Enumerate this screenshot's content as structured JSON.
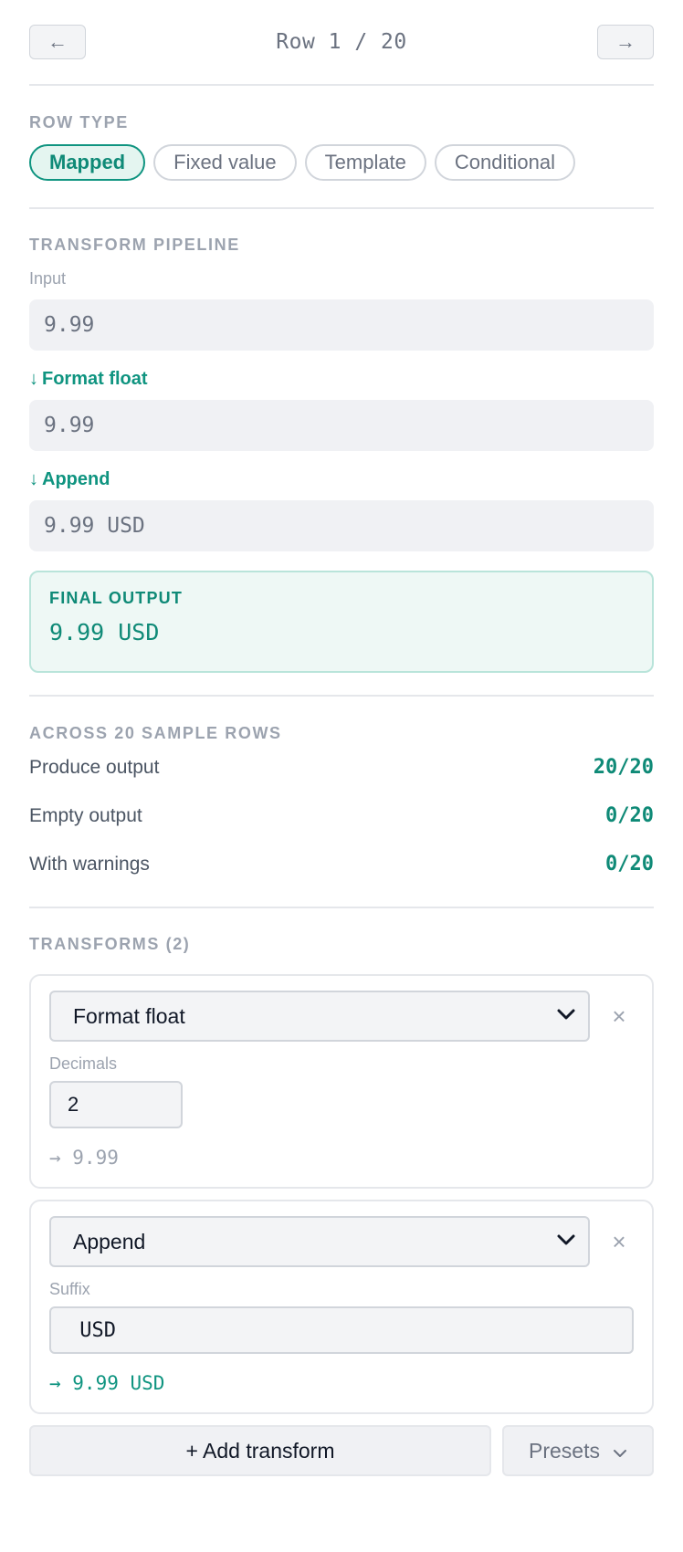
{
  "nav": {
    "prev_icon": "←",
    "next_icon": "→",
    "row_label": "Row 1 / 20"
  },
  "row_type": {
    "title": "ROW TYPE",
    "options": [
      "Mapped",
      "Fixed value",
      "Template",
      "Conditional"
    ],
    "selected": "Mapped"
  },
  "pipeline": {
    "title": "TRANSFORM PIPELINE",
    "input_label": "Input",
    "input_value": "9.99",
    "steps": [
      {
        "arrow": "↓",
        "name": "Format float",
        "value": "9.99"
      },
      {
        "arrow": "↓",
        "name": "Append",
        "value": "9.99 USD"
      }
    ],
    "final_title": "FINAL OUTPUT",
    "final_value": "9.99 USD"
  },
  "stats": {
    "title": "ACROSS 20 SAMPLE ROWS",
    "rows": [
      {
        "label": "Produce output",
        "value": "20/20"
      },
      {
        "label": "Empty output",
        "value": "0/20"
      },
      {
        "label": "With warnings",
        "value": "0/20"
      }
    ]
  },
  "transforms": {
    "title": "TRANSFORMS (2)",
    "items": [
      {
        "type": "Format float",
        "field_label": "Decimals",
        "field_value": "2",
        "preview": "→ 9.99"
      },
      {
        "type": "Append",
        "field_label": "Suffix",
        "field_value": " USD",
        "preview": "→ 9.99 USD"
      }
    ],
    "add_label": "+ Add transform",
    "presets_label": "Presets",
    "chevron": "⌄",
    "close_icon": "×"
  },
  "colors": {
    "accent": "#0f9480",
    "accent_bg": "#e4f5f0",
    "muted": "#9ca3af"
  }
}
